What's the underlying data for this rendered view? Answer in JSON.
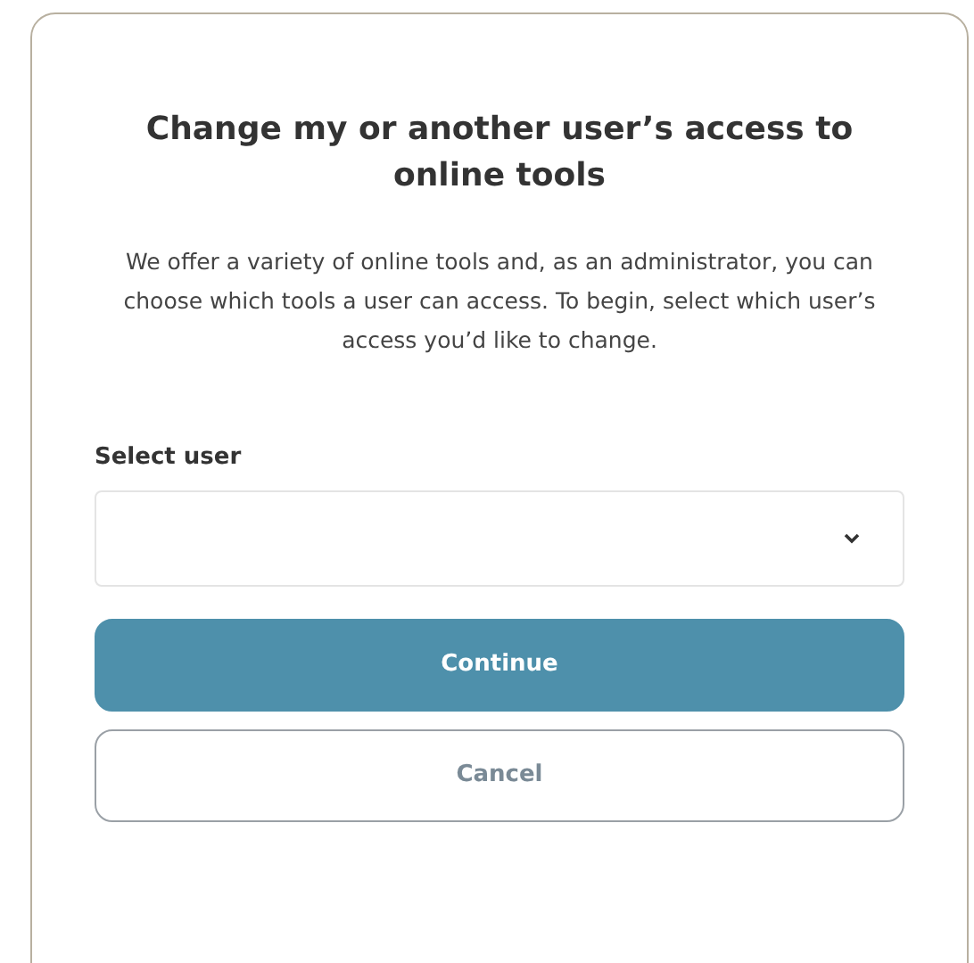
{
  "dialog": {
    "title": "Change my or another user’s access to online tools",
    "description": "We offer a variety of online tools and, as an administrator, you can choose which tools a user can access. To begin, select which user’s access you’d like to change."
  },
  "select": {
    "label": "Select user"
  },
  "buttons": [
    {
      "label": "Continue",
      "kind": "primary"
    },
    {
      "label": "Cancel",
      "kind": "secondary"
    }
  ]
}
